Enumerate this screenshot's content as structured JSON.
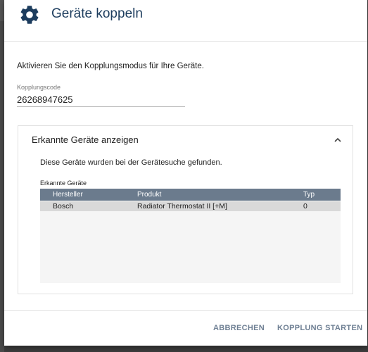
{
  "dialog": {
    "title": "Geräte koppeln",
    "icon": "gear-icon",
    "accent_color": "#1d3d5e"
  },
  "intro": {
    "text": "Aktivieren Sie den Kopplungsmodus für Ihre Geräte."
  },
  "pairing_code": {
    "label": "Kopplungscode",
    "value": "26268947625"
  },
  "panel": {
    "title": "Erkannte Geräte anzeigen",
    "expanded": true,
    "description": "Diese Geräte wurden bei der Gerätesuche gefunden.",
    "table_label": "Erkannte Geräte",
    "columns": [
      "Hersteller",
      "Produkt",
      "Typ"
    ],
    "rows": [
      [
        "Bosch",
        "Radiator Thermostat II [+M]",
        "0"
      ]
    ],
    "header_color": "#6b7b8d"
  },
  "footer": {
    "cancel_label": "ABBRECHEN",
    "start_label": "KOPPLUNG STARTEN"
  }
}
